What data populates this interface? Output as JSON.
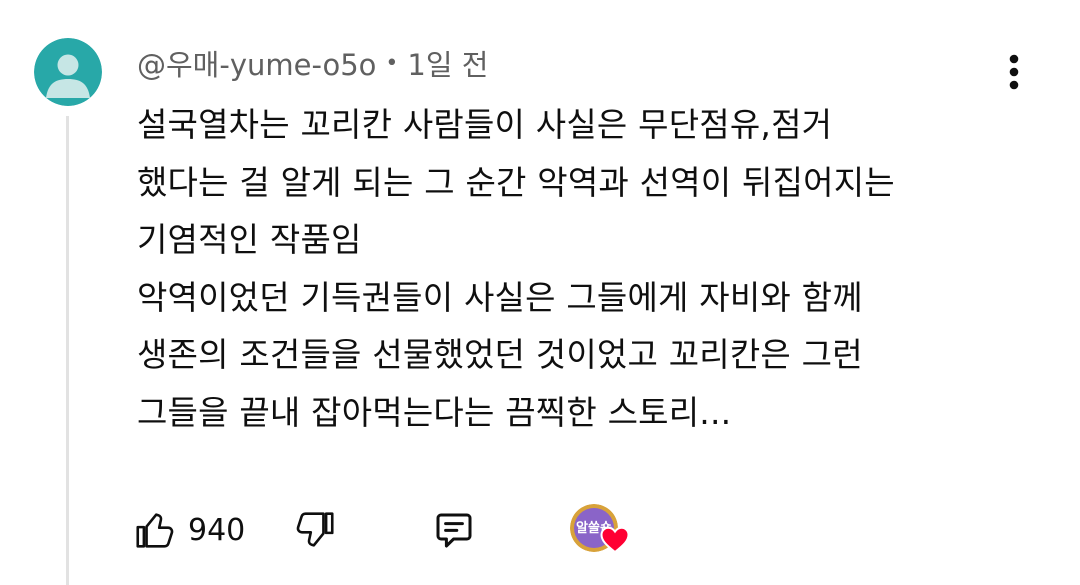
{
  "comment": {
    "author": "@우매-yume-o5o",
    "separator": "•",
    "time": "1일 전",
    "lines": [
      "설국열차는 꼬리칸 사람들이 사실은 무단점유,점거",
      "했다는 걸 알게 되는 그 순간 악역과 선역이 뒤집어지는",
      "기염적인 작품임",
      "악역이었던 기득권들이 사실은 그들에게 자비와 함께",
      "생존의 조건들을 선물했었던 것이었고 꼬리칸은 그런",
      "그들을 끝내 잡아먹는다는 끔찍한 스토리..."
    ]
  },
  "actions": {
    "like_count": "940"
  },
  "creator_heart": {
    "avatar_text": "알쓸숍"
  },
  "icons": {
    "avatar": "default-avatar-icon",
    "more": "more-vertical-icon",
    "like": "thumbs-up-icon",
    "dislike": "thumbs-down-icon",
    "reply": "comment-icon",
    "heart": "heart-icon"
  },
  "colors": {
    "avatar_bg": "#28a8a8",
    "avatar_fg": "#c6e6e5",
    "heart": "#ff0033",
    "text": "#0f0f0f",
    "meta": "#606060",
    "thread": "#e2e2e2"
  }
}
